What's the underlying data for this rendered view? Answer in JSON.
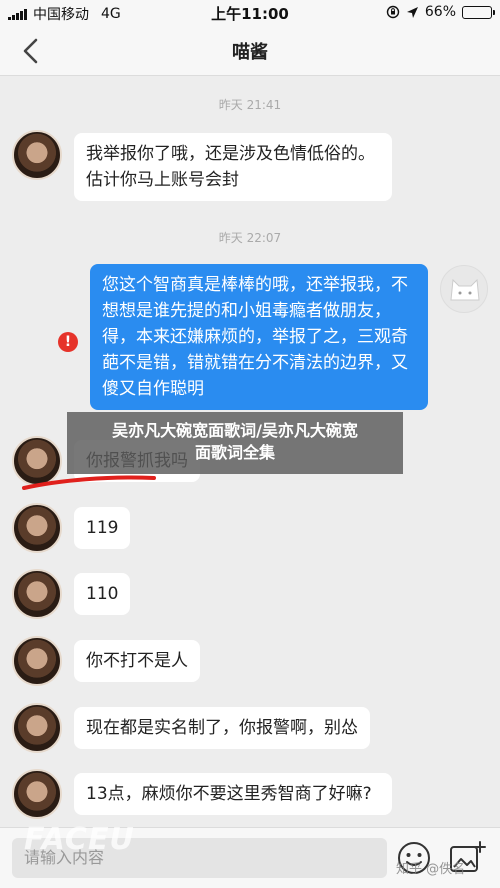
{
  "status_bar": {
    "carrier": "中国移动",
    "network": "4G",
    "time": "上午11:00",
    "battery": "66%",
    "battery_level": 0.66
  },
  "nav": {
    "title": "喵酱",
    "back_icon": "chevron-left-icon"
  },
  "messages": {
    "ts1": "昨天 21:41",
    "m1": "我举报你了哦，还是涉及色情低俗的。估计你马上账号会封",
    "ts2": "昨天 22:07",
    "m2": "您这个智商真是棒棒的哦，还举报我，不想想是谁先提的和小姐毒瘾者做朋友，得，本来还嫌麻烦的，举报了之，三观奇葩不是错，错就错在分不清法的边界，又傻又自作聪明",
    "m3": "你报警抓我吗",
    "m4": "119",
    "m5": "110",
    "m6": "你不打不是人",
    "m7": "现在都是实名制了，你报警啊，别怂",
    "m8": "13点，麻烦你不要这里秀智商了好嘛?",
    "error_mark": "!"
  },
  "overlay": {
    "line1": "吴亦凡大碗宽面歌词/吴亦凡大碗宽",
    "line2": "面歌词全集"
  },
  "input": {
    "placeholder": "请输入内容"
  },
  "watermarks": {
    "left": "FACEU",
    "right": "知乎 @佚名"
  },
  "colors": {
    "sent_bubble": "#2a8cf0",
    "error": "#e6332a",
    "scribble": "#e0201c"
  }
}
